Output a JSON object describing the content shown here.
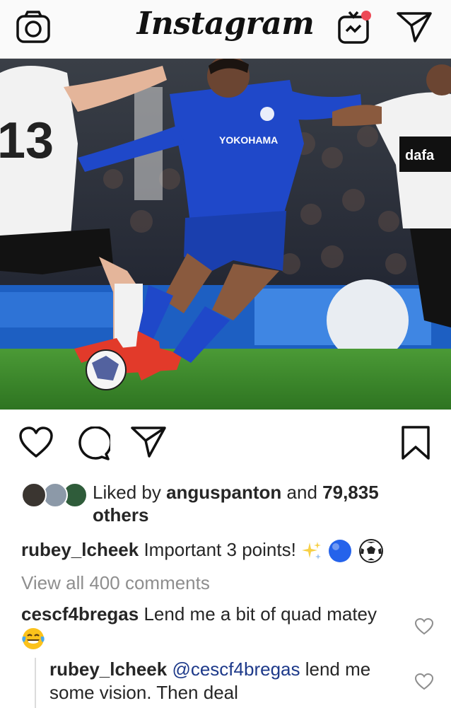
{
  "header": {
    "logo_text": "Instagram",
    "icons": [
      "camera-icon",
      "igtv-icon",
      "direct-message-icon"
    ],
    "igtv_badge_color": "#ed4956"
  },
  "post": {
    "image_alt": "Footballer in blue kit dribbling a ball past white-shirted opponents",
    "actions": [
      "heart-icon",
      "comment-icon",
      "share-icon",
      "bookmark-icon"
    ],
    "likes": {
      "prefix": "Liked by",
      "user": "anguspanton",
      "middle": "and",
      "count": "79,835",
      "suffix": "others"
    },
    "caption": {
      "user": "rubey_lcheek",
      "text": "Important 3 points!"
    },
    "view_all_comments": "View all 400 comments",
    "comments": [
      {
        "user": "cescf4bregas",
        "text": "Lend me a bit of quad matey"
      },
      {
        "user": "rubey_lcheek",
        "mention": "@cescf4bregas",
        "text": "lend me some vision. Then deal"
      }
    ]
  },
  "colors": {
    "text": "#262626",
    "muted": "#8e8e8e",
    "link": "#1e3a8a",
    "kit_blue": "#1f48c9",
    "pitch_green": "#3f8b2c"
  }
}
